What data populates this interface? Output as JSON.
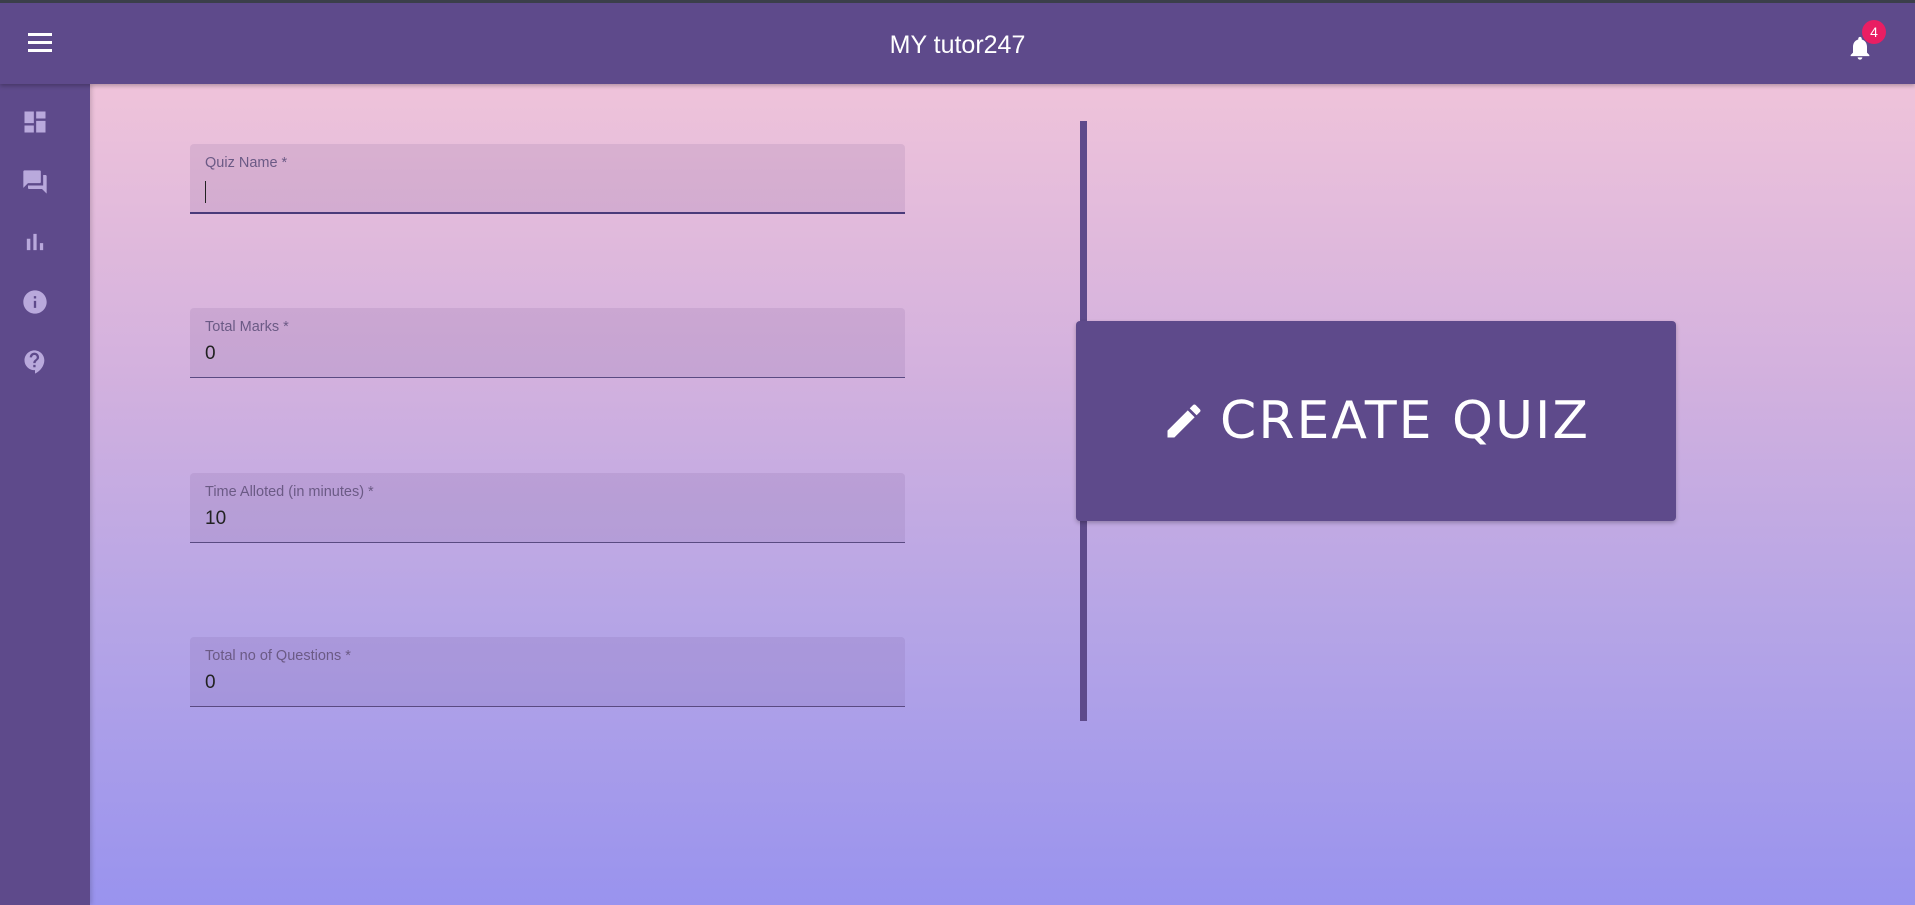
{
  "header": {
    "title": "MY tutor247",
    "notification_count": "4"
  },
  "sidebar": {
    "items": [
      {
        "icon": "dashboard-icon"
      },
      {
        "icon": "forum-icon"
      },
      {
        "icon": "bar-chart-icon"
      },
      {
        "icon": "info-icon"
      },
      {
        "icon": "help-icon"
      }
    ]
  },
  "form": {
    "quiz_name": {
      "label": "Quiz Name *",
      "value": ""
    },
    "total_marks": {
      "label": "Total Marks *",
      "value": "0"
    },
    "time_alloted": {
      "label": "Time Alloted (in minutes) *",
      "value": "10"
    },
    "total_questions": {
      "label": "Total no of Questions *",
      "value": "0"
    }
  },
  "actions": {
    "create_label": "CREATE QUIZ"
  },
  "colors": {
    "primary": "#5e4a8b",
    "badge": "#e91e63"
  }
}
